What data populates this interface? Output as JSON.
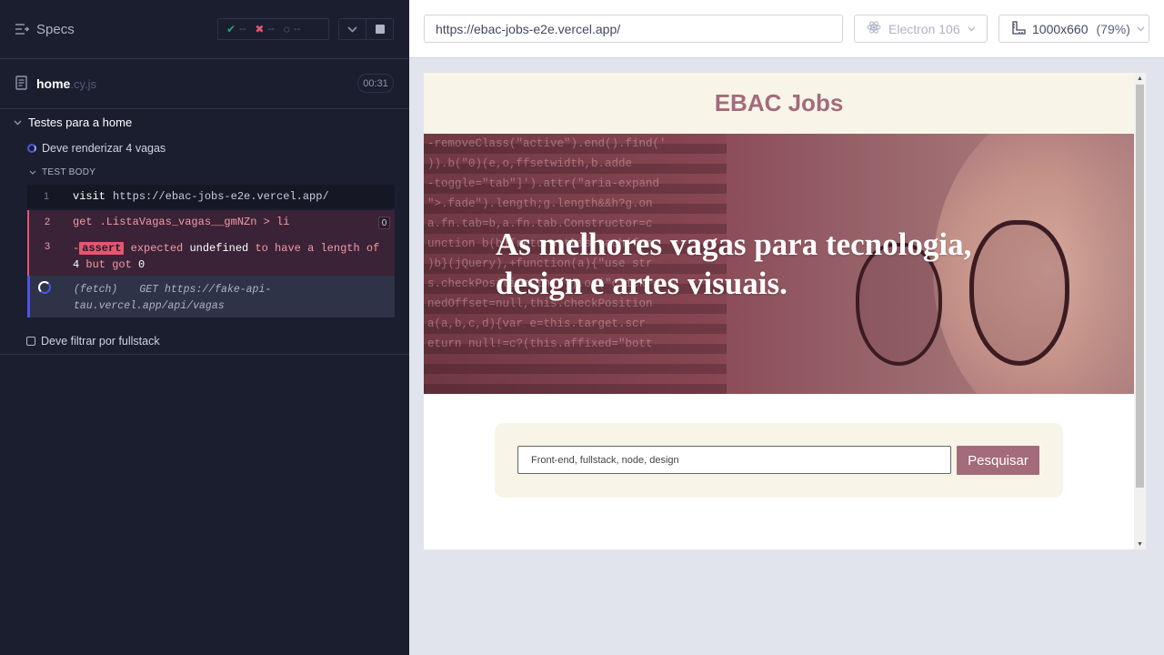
{
  "reporter": {
    "specs_label": "Specs",
    "stats": {
      "passed": "--",
      "failed": "--",
      "pending": "--"
    },
    "spec": {
      "name": "home",
      "ext": ".cy.js",
      "duration": "00:31"
    },
    "suite_title": "Testes para a home",
    "test_running": "Deve renderizar 4 vagas",
    "test_body_label": "TEST BODY",
    "commands": [
      {
        "num": "1",
        "name": "visit",
        "arg": "https://ebac-jobs-e2e.vercel.app/"
      },
      {
        "num": "2",
        "name": "get",
        "arg": ".ListaVagas_vagas__gmNZn > li",
        "count": "0"
      },
      {
        "num": "3",
        "prefix": "-",
        "chip": "assert",
        "w1": "expected",
        "w2": "undefined",
        "w3": "to have a length of",
        "w4": "4",
        "w5": "but got",
        "w6": "0"
      },
      {
        "label": "(fetch)",
        "method": "GET",
        "url": "https://fake-api-tau.vercel.app/api/vagas"
      }
    ],
    "test_pending": "Deve filtrar por fullstack"
  },
  "aut": {
    "url": "https://ebac-jobs-e2e.vercel.app/",
    "browser": "Electron 106",
    "viewport": "1000x660",
    "zoom": "(79%)"
  },
  "site": {
    "title": "EBAC Jobs",
    "hero_text": "As melhores vagas para tecnologia, design e artes visuais.",
    "search_placeholder": "Front-end, fullstack, node, design",
    "search_button": "Pesquisar"
  },
  "colors": {
    "reporter_bg": "#1b1e2e",
    "fail": "#e45770",
    "pass": "#1fa971",
    "running": "#4956e3",
    "brand": "#a36b7b",
    "site_cream": "#f8f5e8"
  }
}
